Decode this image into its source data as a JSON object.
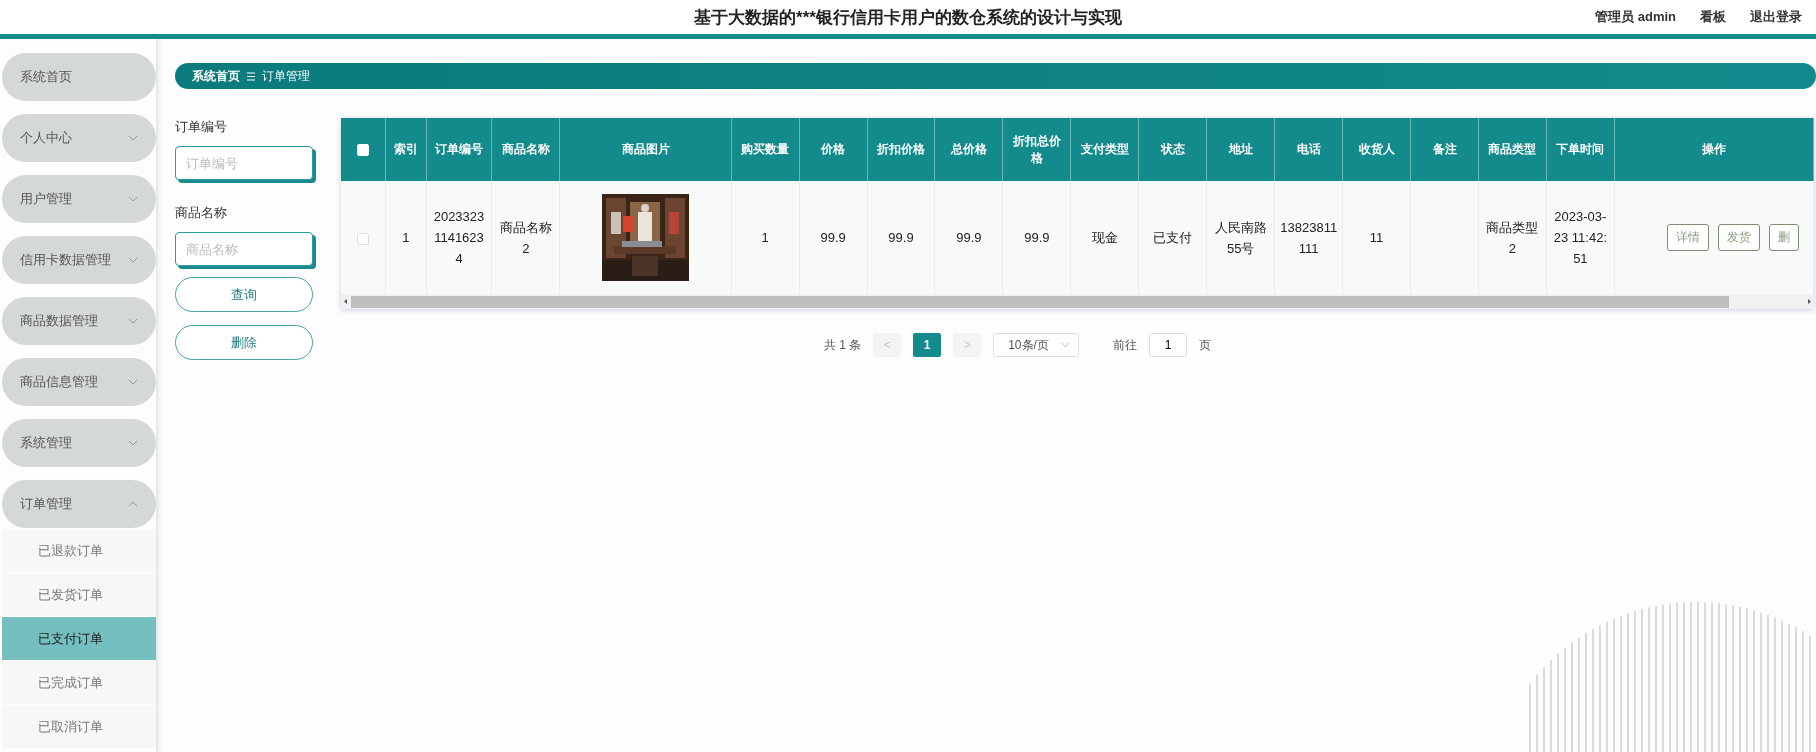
{
  "header": {
    "title": "基于大数据的***银行信用卡用户的数仓系统的设计与实现",
    "user": "管理员 admin",
    "links": [
      "看板",
      "退出登录"
    ]
  },
  "sidebar": {
    "home_item": {
      "label": "系统首页"
    },
    "menus": [
      {
        "label": "个人中心",
        "expanded": false
      },
      {
        "label": "用户管理",
        "expanded": false
      },
      {
        "label": "信用卡数据管理",
        "expanded": false
      },
      {
        "label": "商品数据管理",
        "expanded": false
      },
      {
        "label": "商品信息管理",
        "expanded": false
      },
      {
        "label": "系统管理",
        "expanded": false
      },
      {
        "label": "订单管理",
        "expanded": true,
        "children": [
          {
            "label": "已退款订单",
            "selected": false
          },
          {
            "label": "已发货订单",
            "selected": false
          },
          {
            "label": "已支付订单",
            "selected": true
          },
          {
            "label": "已完成订单",
            "selected": false
          },
          {
            "label": "已取消订单",
            "selected": false
          }
        ]
      }
    ]
  },
  "breadcrumb": [
    "系统首页",
    "订单管理"
  ],
  "filters": {
    "fields": [
      {
        "label": "订单编号",
        "placeholder": "订单编号"
      },
      {
        "label": "商品名称",
        "placeholder": "商品名称"
      }
    ],
    "buttons": [
      "查询",
      "删除"
    ]
  },
  "table": {
    "columns": [
      {
        "kind": "check",
        "checked": false
      },
      {
        "kind": "text",
        "label": "索引"
      },
      {
        "kind": "text",
        "label": "订单编号"
      },
      {
        "kind": "text",
        "label": "商品名称"
      },
      {
        "kind": "picture",
        "label": "商品图片"
      },
      {
        "kind": "text",
        "label": "购买数量"
      },
      {
        "kind": "text",
        "label": "价格"
      },
      {
        "kind": "text",
        "label": "折扣价格"
      },
      {
        "kind": "text",
        "label": "总价格"
      },
      {
        "kind": "text",
        "label": "折扣总价格"
      },
      {
        "kind": "text",
        "label": "支付类型"
      },
      {
        "kind": "text",
        "label": "状态"
      },
      {
        "kind": "text",
        "label": "地址"
      },
      {
        "kind": "text",
        "label": "电话"
      },
      {
        "kind": "text",
        "label": "收货人"
      },
      {
        "kind": "text",
        "label": "备注"
      },
      {
        "kind": "text",
        "label": "商品类型"
      },
      {
        "kind": "text",
        "label": "下单时间"
      },
      {
        "kind": "actions",
        "label": "操作"
      }
    ],
    "rows": [
      {
        "cells": [
          {
            "kind": "check",
            "checked": false
          },
          {
            "kind": "text",
            "text": "1"
          },
          {
            "kind": "text",
            "text": "202332311416234"
          },
          {
            "kind": "text",
            "text": "商品名称2"
          },
          {
            "kind": "picture"
          },
          {
            "kind": "text",
            "text": "1"
          },
          {
            "kind": "text",
            "text": "99.9"
          },
          {
            "kind": "text",
            "text": "99.9"
          },
          {
            "kind": "text",
            "text": "99.9"
          },
          {
            "kind": "text",
            "text": "99.9"
          },
          {
            "kind": "text",
            "text": "现金"
          },
          {
            "kind": "text",
            "text": "已支付"
          },
          {
            "kind": "text",
            "text": "人民南路55号"
          },
          {
            "kind": "text",
            "text": "13823811111"
          },
          {
            "kind": "text",
            "text": "11"
          },
          {
            "kind": "empty"
          },
          {
            "kind": "text",
            "text": "商品类型2"
          },
          {
            "kind": "text",
            "text": "2023-03-23 11:42:51"
          },
          {
            "kind": "actions",
            "buttons": [
              "详情",
              "发货",
              "删"
            ]
          }
        ]
      }
    ]
  },
  "pagination": {
    "total": "共 1 条",
    "prev": "<",
    "pages": [
      {
        "label": "1",
        "selected": true
      }
    ],
    "next": ">",
    "page_size": "10条/页",
    "goto_label": "前往",
    "goto_value": "1",
    "goto_suffix": "页"
  }
}
